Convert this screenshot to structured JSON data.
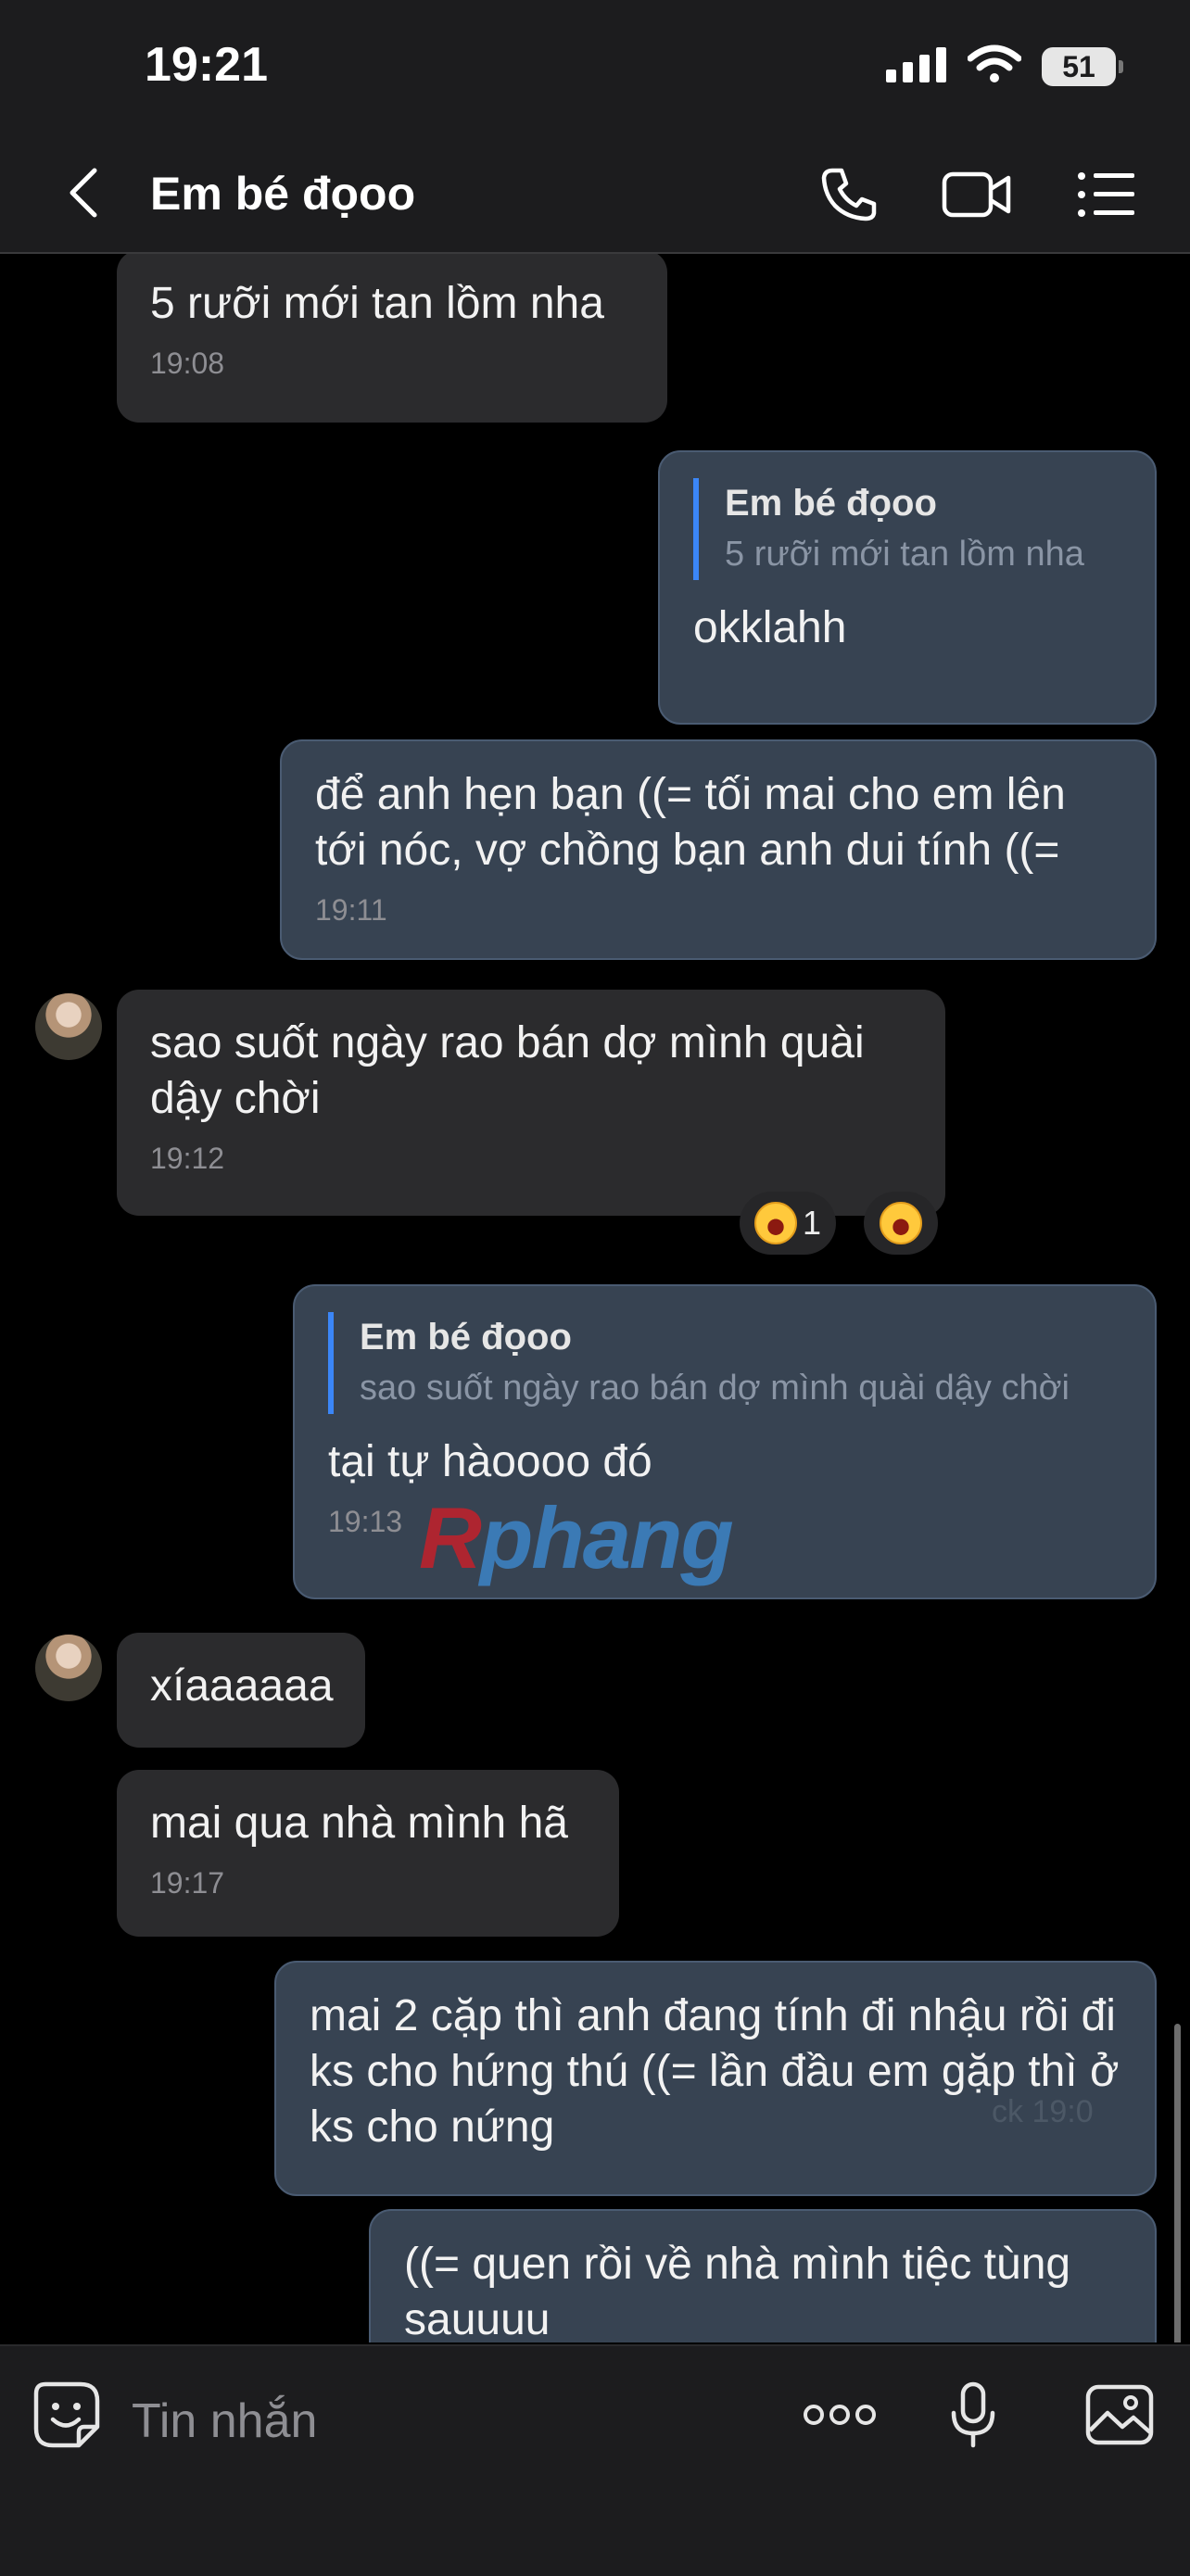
{
  "status_bar": {
    "time": "19:21",
    "battery": "51"
  },
  "header": {
    "title": "Em bé đọoo"
  },
  "messages": [
    {
      "text": "5 rưỡi mới  tan lồm nha",
      "time": "19:08"
    },
    {
      "quote_name": "Em bé đọoo",
      "quote_text": "5 rưỡi mới  tan lồm nha",
      "text": "okklahh"
    },
    {
      "text": "để anh hẹn bạn ((= tối mai cho em lên tới nóc, vợ chồng bạn anh dui tính ((=",
      "time": "19:11"
    },
    {
      "text": "sao suốt ngày rao bán dợ mình quài dậy chời",
      "time": "19:12",
      "reaction_count": "1"
    },
    {
      "quote_name": "Em bé đọoo",
      "quote_text": "sao suốt ngày rao bán dợ mình quài dậy chời",
      "text": "tại tự hàoooo đó",
      "time": "19:13"
    },
    {
      "text": "xíaaaaaa"
    },
    {
      "text": "mai qua nhà mình hã",
      "time": "19:17"
    },
    {
      "text": "mai 2 cặp thì anh đang tính đi nhậu rồi đi ks cho hứng thú ((= lần đầu em gặp thì ở ks cho nứng"
    },
    {
      "text": "((= quen rồi về nhà mình tiệc tùng sauuuu"
    }
  ],
  "watermark": {
    "part1": "R",
    "part2": "phang"
  },
  "ghost_text": "ck 19:0",
  "composer": {
    "placeholder": "Tin nhắn"
  },
  "icons": {
    "back": "chevron-left-icon",
    "call": "phone-icon",
    "video": "video-camera-icon",
    "menu": "list-menu-icon",
    "sticker": "sticker-face-icon",
    "more": "more-dots-icon",
    "mic": "microphone-icon",
    "image": "image-icon",
    "reaction": "laughing-face-icon"
  },
  "colors": {
    "incoming_bubble": "#2b2b2d",
    "outgoing_bubble": "#374352",
    "quote_bar": "#3b86f7",
    "background": "#000000"
  }
}
